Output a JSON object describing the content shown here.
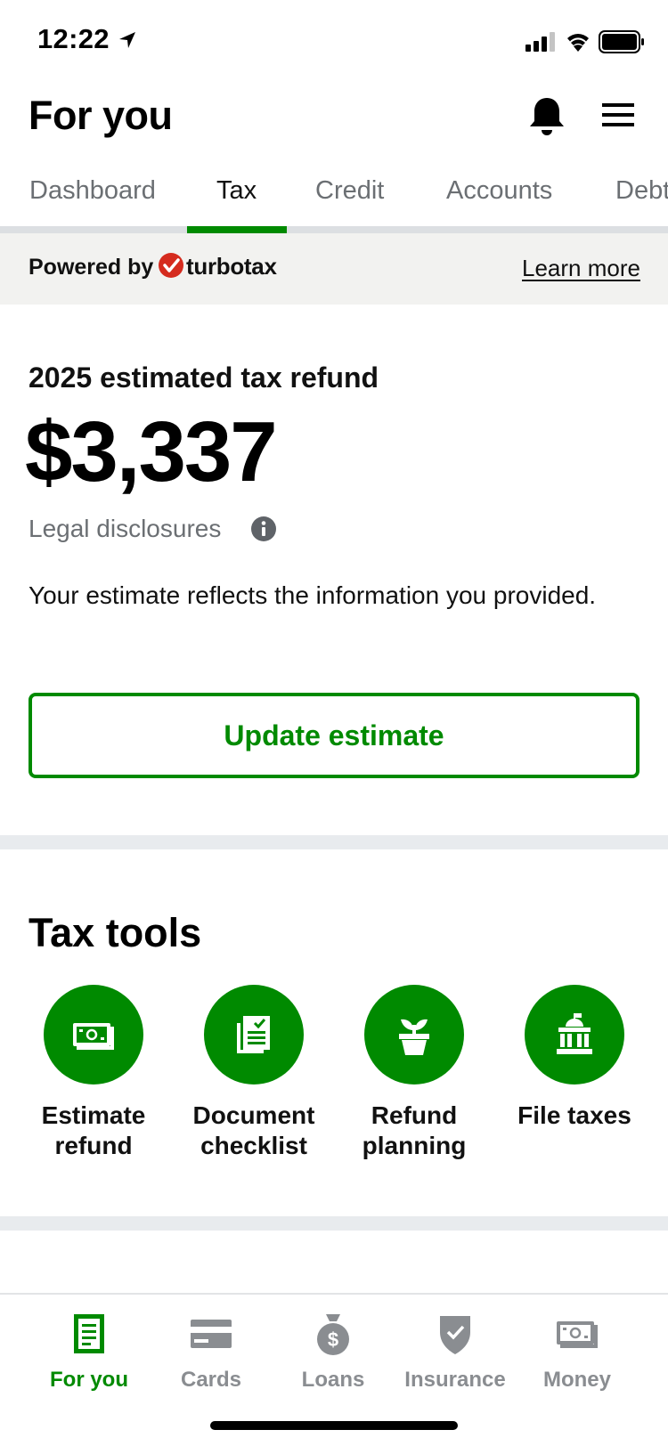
{
  "status_bar": {
    "time": "12:22"
  },
  "header": {
    "title": "For you"
  },
  "tabs": [
    {
      "label": "Dashboard"
    },
    {
      "label": "Tax"
    },
    {
      "label": "Credit"
    },
    {
      "label": "Accounts"
    },
    {
      "label": "Debt"
    }
  ],
  "active_tab": "Tax",
  "powered_by": {
    "label": "Powered by",
    "brand": "turbotax",
    "link": "Learn more"
  },
  "refund": {
    "label": "2025 estimated tax refund",
    "amount": "$3,337",
    "legal": "Legal disclosures",
    "description": "Your estimate reflects the information you provided.",
    "button": "Update estimate"
  },
  "tax_tools": {
    "title": "Tax tools",
    "items": [
      {
        "label_line1": "Estimate",
        "label_line2": "refund",
        "icon": "cash-icon"
      },
      {
        "label_line1": "Document",
        "label_line2": "checklist",
        "icon": "checklist-icon"
      },
      {
        "label_line1": "Refund",
        "label_line2": "planning",
        "icon": "plant-icon"
      },
      {
        "label_line1": "File taxes",
        "label_line2": "",
        "icon": "government-building-icon"
      }
    ]
  },
  "bottom_nav": {
    "items": [
      {
        "label": "For you",
        "icon": "document-icon"
      },
      {
        "label": "Cards",
        "icon": "credit-card-icon"
      },
      {
        "label": "Loans",
        "icon": "money-bag-icon"
      },
      {
        "label": "Insurance",
        "icon": "shield-check-icon"
      },
      {
        "label": "Money",
        "icon": "cash-icon"
      }
    ],
    "active": "For you"
  },
  "colors": {
    "accent": "#008a00",
    "inactive": "#8a8d91",
    "brand_red": "#d52b1e"
  }
}
